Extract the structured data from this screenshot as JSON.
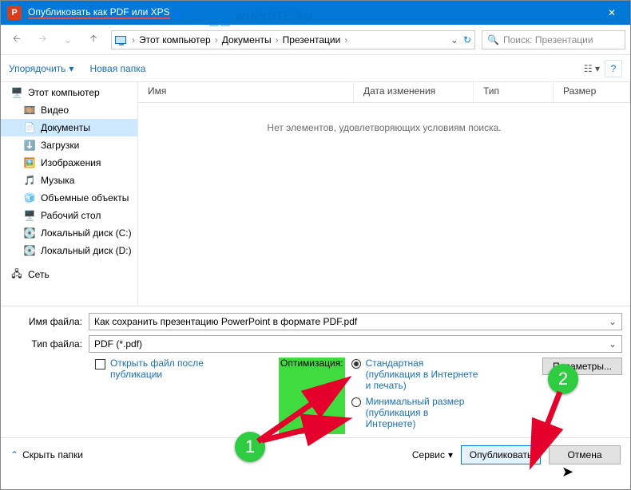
{
  "title": "Опубликовать как PDF или XPS",
  "watermark": "WINNOTE.RU",
  "breadcrumb": {
    "pc": "Этот компьютер",
    "docs": "Документы",
    "pres": "Презентации"
  },
  "search": {
    "placeholder": "Поиск: Презентации"
  },
  "toolbar": {
    "organize": "Упорядочить",
    "newfolder": "Новая папка"
  },
  "columns": {
    "name": "Имя",
    "date": "Дата изменения",
    "type": "Тип",
    "size": "Размер"
  },
  "empty": "Нет элементов, удовлетворяющих условиям поиска.",
  "sidebar": {
    "pc": "Этот компьютер",
    "video": "Видео",
    "docs": "Документы",
    "downloads": "Загрузки",
    "images": "Изображения",
    "music": "Музыка",
    "objects": "Объемные объекты",
    "desktop": "Рабочий стол",
    "diskc": "Локальный диск (C:)",
    "diskd": "Локальный диск (D:)",
    "network": "Сеть"
  },
  "labels": {
    "filename": "Имя файла:",
    "filetype": "Тип файла:"
  },
  "filename": "Как сохранить презентацию PowerPoint в формате PDF.pdf",
  "filetype": "PDF (*.pdf)",
  "openafter": "Открыть файл после публикации",
  "optimization": "Оптимизация:",
  "radio1": "Стандартная (публикация в Интернете и печать)",
  "radio2": "Минимальный размер (публикация в Интернете)",
  "params": "Параметры...",
  "hide": "Скрыть папки",
  "service": "Сервис",
  "publish": "Опубликовать",
  "cancel": "Отмена",
  "badges": {
    "one": "1",
    "two": "2"
  }
}
